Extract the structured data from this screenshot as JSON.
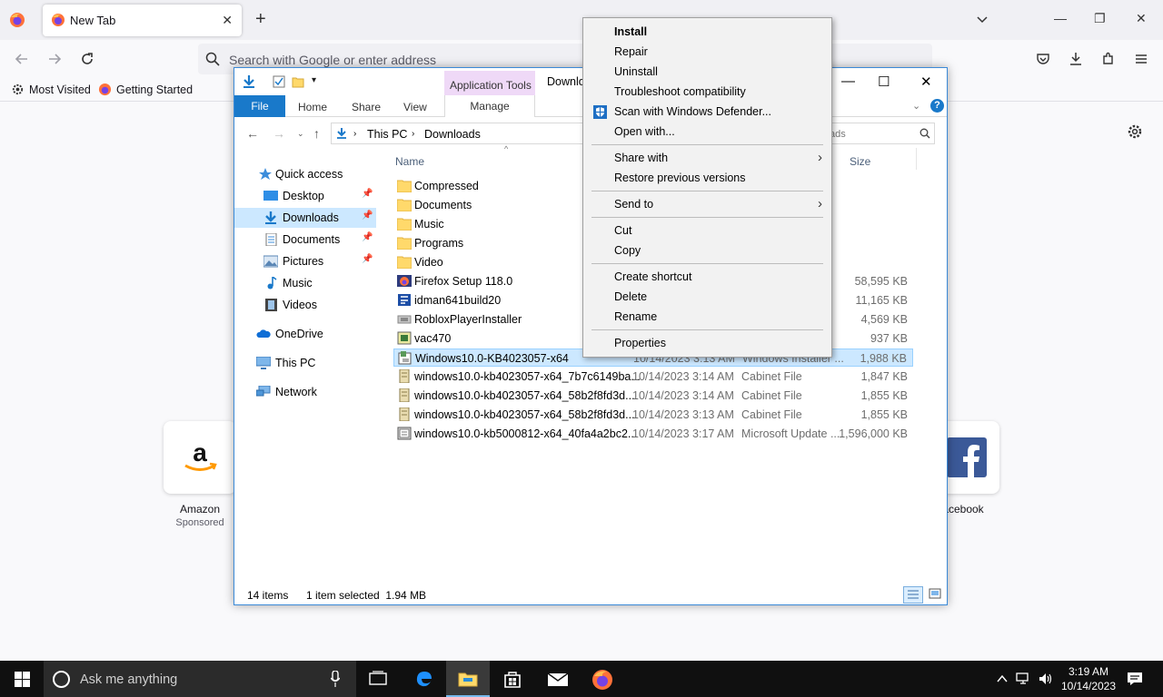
{
  "firefox": {
    "tab_title": "New Tab",
    "url_placeholder": "Search with Google or enter address",
    "bookmarks": [
      "Most Visited",
      "Getting Started"
    ],
    "shortcuts": [
      {
        "label": "Amazon",
        "sub": "Sponsored"
      },
      {
        "label": "acebook",
        "sub": ""
      }
    ]
  },
  "explorer": {
    "app_tools": "Application Tools",
    "title": "Downlo",
    "ribbon": {
      "file": "File",
      "home": "Home",
      "share": "Share",
      "view": "View",
      "manage": "Manage"
    },
    "breadcrumb": [
      "This PC",
      "Downloads"
    ],
    "search_placeholder": "ads",
    "columns": {
      "name": "Name",
      "size": "Size"
    },
    "sidebar": [
      {
        "label": "Quick access",
        "icon": "star-icon",
        "pin": false
      },
      {
        "label": "Desktop",
        "icon": "desktop-icon",
        "pin": true
      },
      {
        "label": "Downloads",
        "icon": "download-arrow-icon",
        "pin": true
      },
      {
        "label": "Documents",
        "icon": "document-icon",
        "pin": true
      },
      {
        "label": "Pictures",
        "icon": "picture-icon",
        "pin": true
      },
      {
        "label": "Music",
        "icon": "music-note-icon",
        "pin": false
      },
      {
        "label": "Videos",
        "icon": "video-icon",
        "pin": false
      },
      {
        "label": "OneDrive",
        "icon": "cloud-icon",
        "pin": false
      },
      {
        "label": "This PC",
        "icon": "monitor-icon",
        "pin": false
      },
      {
        "label": "Network",
        "icon": "network-icon",
        "pin": false
      }
    ],
    "files": [
      {
        "name": "Compressed",
        "date": "",
        "type": "",
        "size": "",
        "icon": "folder-icon"
      },
      {
        "name": "Documents",
        "date": "",
        "type": "",
        "size": "",
        "icon": "folder-icon"
      },
      {
        "name": "Music",
        "date": "",
        "type": "",
        "size": "",
        "icon": "folder-icon"
      },
      {
        "name": "Programs",
        "date": "",
        "type": "",
        "size": "",
        "icon": "folder-icon"
      },
      {
        "name": "Video",
        "date": "",
        "type": "",
        "size": "",
        "icon": "folder-icon"
      },
      {
        "name": "Firefox Setup 118.0",
        "date": "",
        "type": "",
        "size": "58,595 KB",
        "icon": "firefox-setup-icon"
      },
      {
        "name": "idman641build20",
        "date": "",
        "type": "",
        "size": "11,165 KB",
        "icon": "idm-icon"
      },
      {
        "name": "RobloxPlayerInstaller",
        "date": "",
        "type": "",
        "size": "4,569 KB",
        "icon": "roblox-icon"
      },
      {
        "name": "vac470",
        "date": "",
        "type": "",
        "size": "937 KB",
        "icon": "installer-icon"
      },
      {
        "name": "Windows10.0-KB4023057-x64",
        "date": "10/14/2023 3:13 AM",
        "type": "Windows Installer ...",
        "size": "1,988 KB",
        "icon": "msi-icon"
      },
      {
        "name": "windows10.0-kb4023057-x64_7b7c6149ba...",
        "date": "10/14/2023 3:14 AM",
        "type": "Cabinet File",
        "size": "1,847 KB",
        "icon": "cabinet-icon"
      },
      {
        "name": "windows10.0-kb4023057-x64_58b2f8fd3d...",
        "date": "10/14/2023 3:14 AM",
        "type": "Cabinet File",
        "size": "1,855 KB",
        "icon": "cabinet-icon"
      },
      {
        "name": "windows10.0-kb4023057-x64_58b2f8fd3d...",
        "date": "10/14/2023 3:13 AM",
        "type": "Cabinet File",
        "size": "1,855 KB",
        "icon": "cabinet-icon"
      },
      {
        "name": "windows10.0-kb5000812-x64_40fa4a2bc2...",
        "date": "10/14/2023 3:17 AM",
        "type": "Microsoft Update ...",
        "size": "1,596,000 KB",
        "icon": "update-package-icon"
      }
    ],
    "status": {
      "items": "14 items",
      "selected": "1 item selected  1.94 MB"
    }
  },
  "context_menu": {
    "items": [
      {
        "label": "Install",
        "bold": true,
        "submenu": false
      },
      {
        "label": "Repair",
        "bold": false,
        "submenu": false
      },
      {
        "label": "Uninstall",
        "bold": false,
        "submenu": false
      },
      {
        "label": "Troubleshoot compatibility",
        "bold": false,
        "submenu": false
      },
      {
        "label": "Scan with Windows Defender...",
        "bold": false,
        "submenu": false
      },
      {
        "label": "Open with...",
        "bold": false,
        "submenu": false
      },
      {
        "label": "Share with",
        "bold": false,
        "submenu": true
      },
      {
        "label": "Restore previous versions",
        "bold": false,
        "submenu": false
      },
      {
        "label": "Send to",
        "bold": false,
        "submenu": true
      },
      {
        "label": "Cut",
        "bold": false,
        "submenu": false
      },
      {
        "label": "Copy",
        "bold": false,
        "submenu": false
      },
      {
        "label": "Create shortcut",
        "bold": false,
        "submenu": false
      },
      {
        "label": "Delete",
        "bold": false,
        "submenu": false
      },
      {
        "label": "Rename",
        "bold": false,
        "submenu": false
      },
      {
        "label": "Properties",
        "bold": false,
        "submenu": false
      }
    ]
  },
  "taskbar": {
    "search_placeholder": "Ask me anything",
    "time": "3:19 AM",
    "date": "10/14/2023"
  },
  "colors": {
    "selection": "#cce8ff",
    "accent": "#1979ca",
    "app_tools": "#efd9f7"
  }
}
